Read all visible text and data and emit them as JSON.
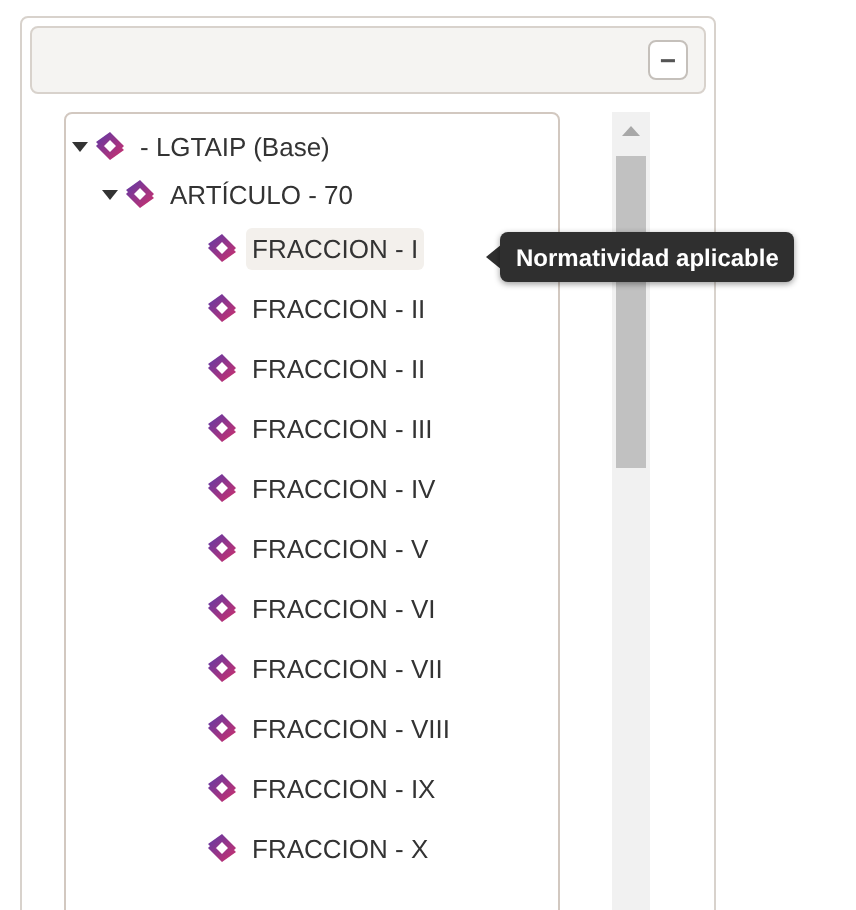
{
  "panel": {
    "collapse_button": "−"
  },
  "tree": [
    {
      "label": "- LGTAIP (Base)",
      "expanded": true,
      "selected": false,
      "children": [
        {
          "label": "ARTÍCULO - 70",
          "expanded": true,
          "selected": false,
          "children": [
            {
              "label": "FRACCION - I",
              "selected": true
            },
            {
              "label": "FRACCION - II",
              "selected": false
            },
            {
              "label": "FRACCION - II",
              "selected": false
            },
            {
              "label": "FRACCION - III",
              "selected": false
            },
            {
              "label": "FRACCION - IV",
              "selected": false
            },
            {
              "label": "FRACCION - V",
              "selected": false
            },
            {
              "label": "FRACCION - VI",
              "selected": false
            },
            {
              "label": "FRACCION - VII",
              "selected": false
            },
            {
              "label": "FRACCION - VIII",
              "selected": false
            },
            {
              "label": "FRACCION - IX",
              "selected": false
            },
            {
              "label": "FRACCION - X",
              "selected": false
            }
          ]
        }
      ]
    }
  ],
  "tooltip": {
    "text": "Normatividad aplicable"
  }
}
